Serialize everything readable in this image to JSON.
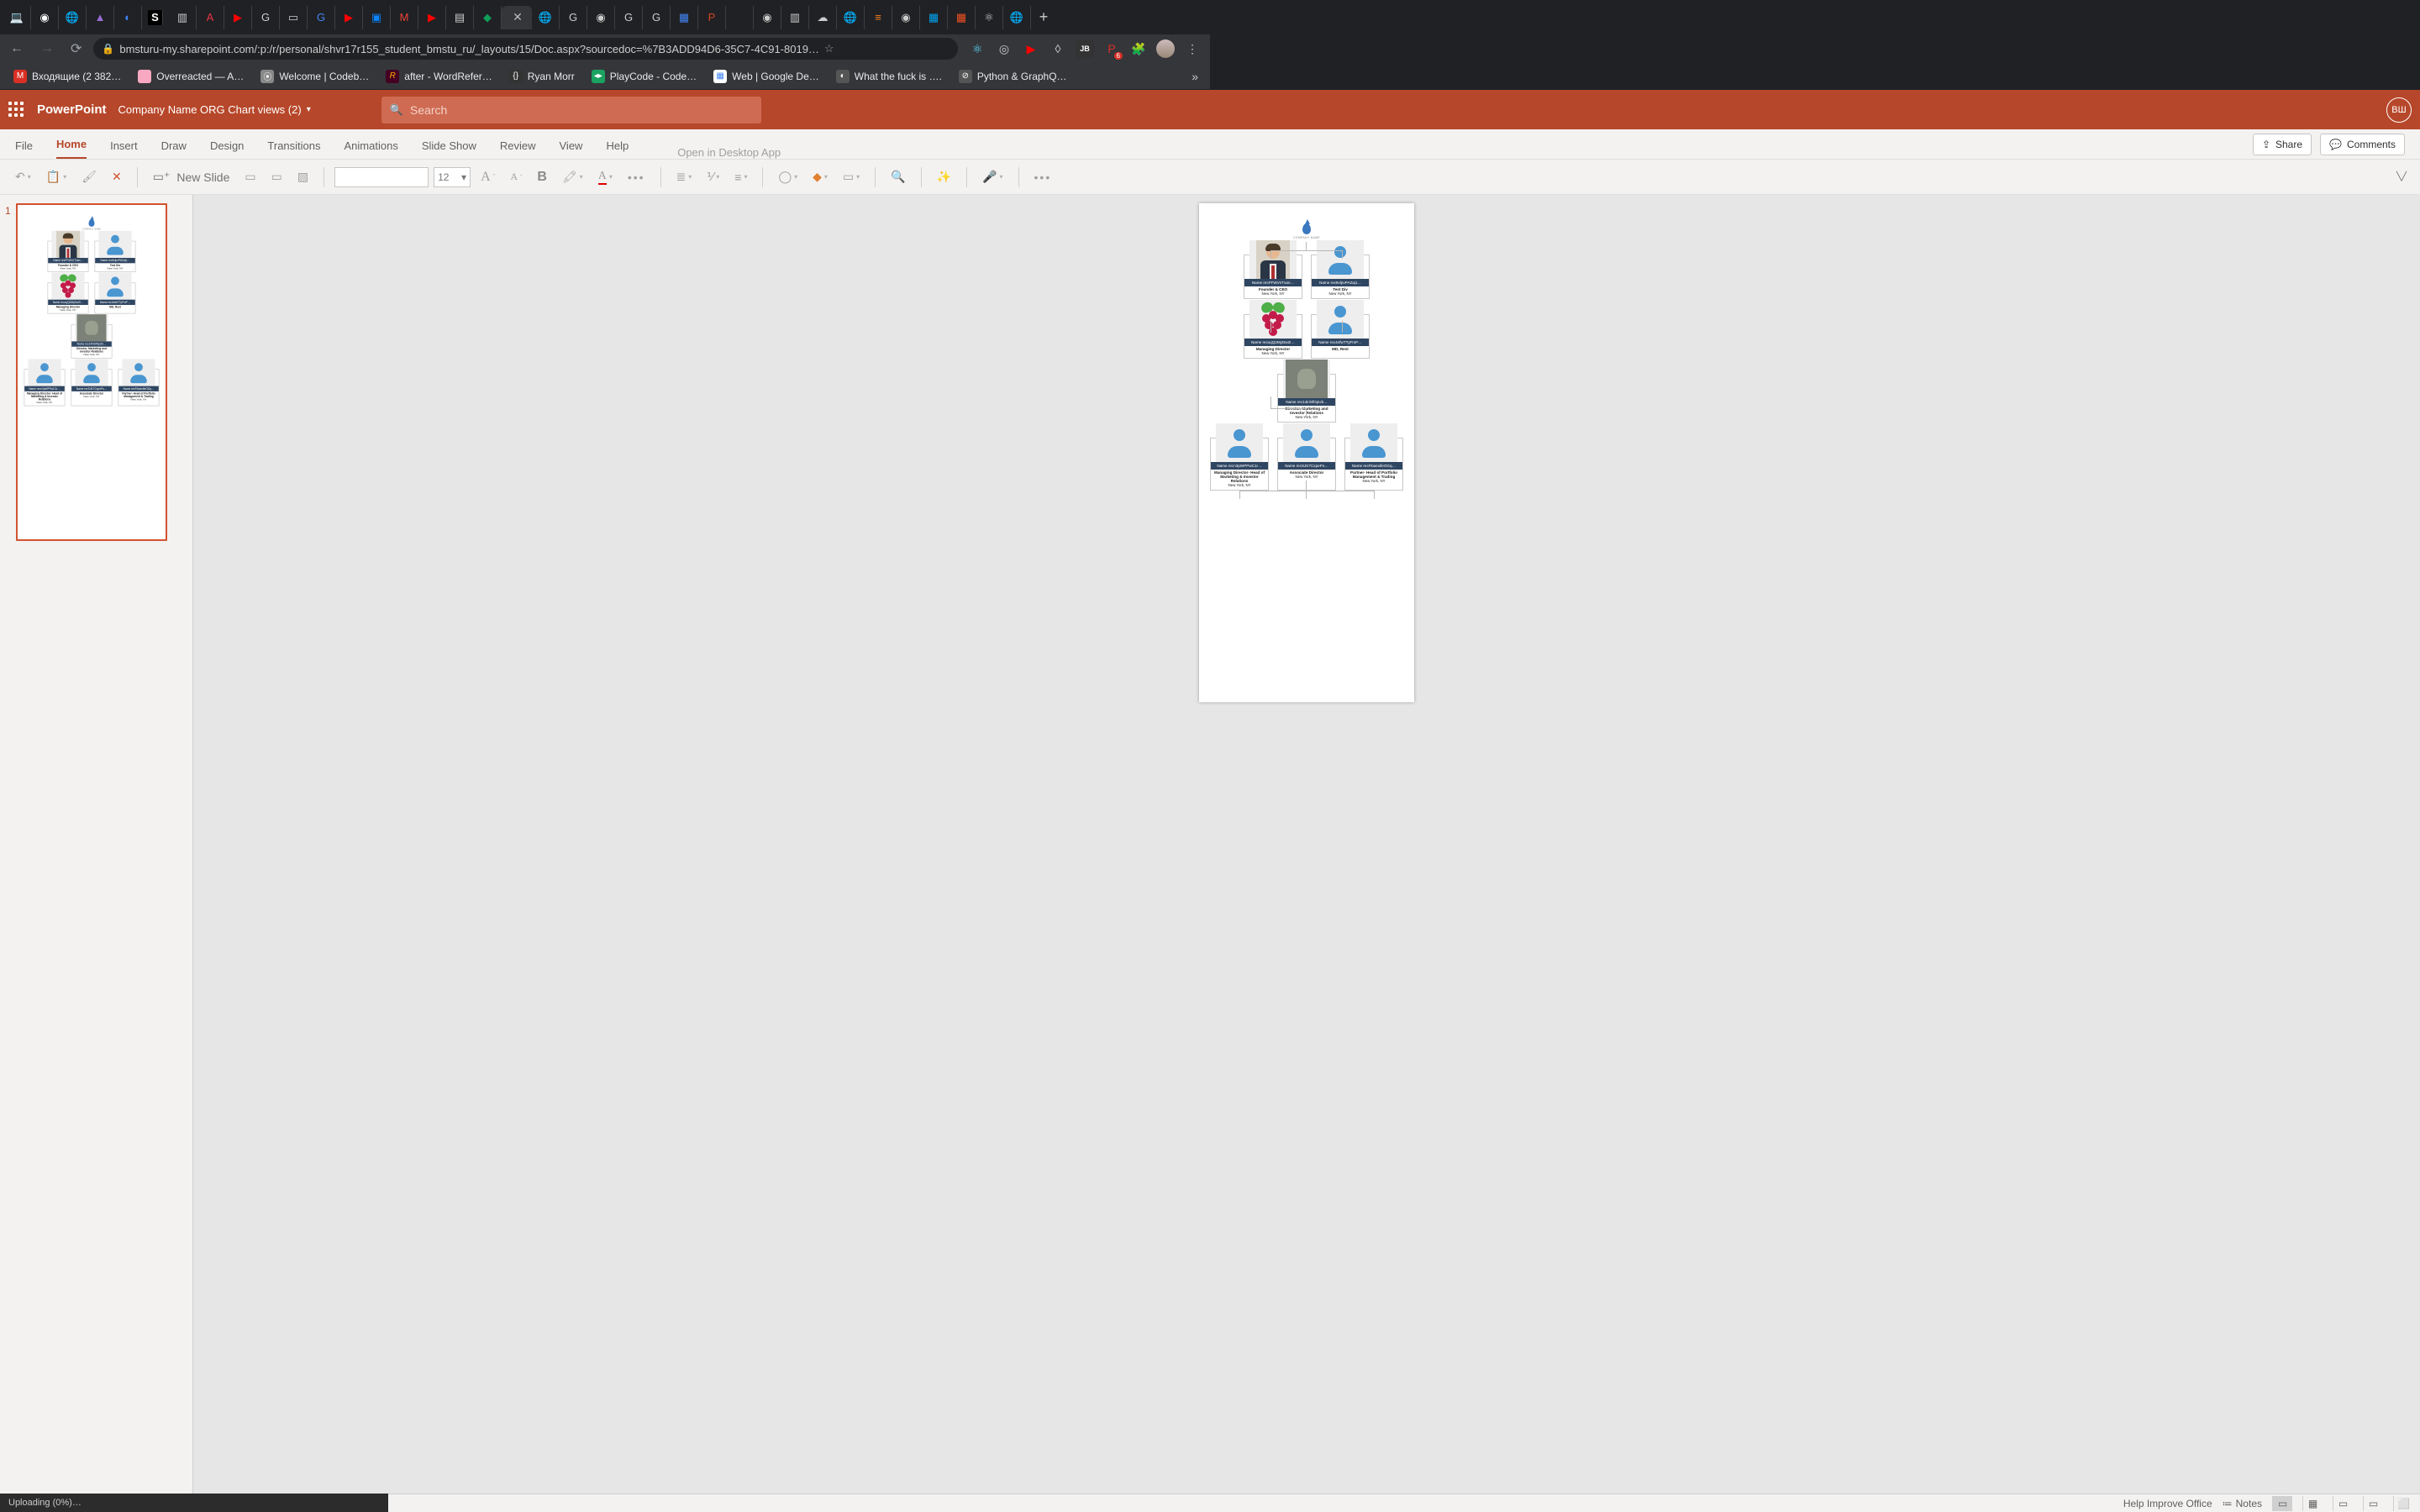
{
  "browser": {
    "url": "bmsturu-my.sharepoint.com/:p:/r/personal/shvr17r155_student_bmstu_ru/_layouts/15/Doc.aspx?sourcedoc=%7B3ADD94D6-35C7-4C91-8019…",
    "tabs_icons": [
      "laptop",
      "github",
      "cloud",
      "A",
      "cycle",
      "S",
      "book",
      "A",
      "yt",
      "G",
      "pad",
      "G",
      "yt",
      "app",
      "M",
      "yt",
      "doc",
      "drive",
      "active",
      "globe",
      "G",
      "github",
      "G",
      "G",
      "G",
      "P",
      "blank",
      "github",
      "book",
      "cloud",
      "globe",
      "so",
      "github",
      "grid",
      "grid",
      "atom",
      "globe"
    ],
    "bookmarks": [
      {
        "icon": "M",
        "text": "Входящие (2 382…",
        "color": "#d93025"
      },
      {
        "icon": "●",
        "text": "Overreacted — A…",
        "color": "#f9a8c1"
      },
      {
        "icon": "⦿",
        "text": "Welcome | Codeb…",
        "color": "#6b6b6b"
      },
      {
        "icon": "R",
        "text": "after - WordRefer…",
        "color": "#c03"
      },
      {
        "icon": "{}",
        "text": "Ryan Morr",
        "color": "#444"
      },
      {
        "icon": "<>",
        "text": "PlayCode - Code…",
        "color": "#1aa260"
      },
      {
        "icon": "▦",
        "text": "Web  |  Google De…",
        "color": "#4285f4"
      },
      {
        "icon": "◐",
        "text": "What the fuck is ….",
        "color": "#555"
      },
      {
        "icon": "⊘",
        "text": "Python & GraphQ…",
        "color": "#555"
      }
    ],
    "ext_badge": "6"
  },
  "app": {
    "name": "PowerPoint",
    "doc": "Company Name ORG Chart views (2)",
    "search_placeholder": "Search",
    "user_initials": "ВШ",
    "ribbon_tabs": [
      "File",
      "Home",
      "Insert",
      "Draw",
      "Design",
      "Transitions",
      "Animations",
      "Slide Show",
      "Review",
      "View",
      "Help"
    ],
    "active_tab": "Home",
    "open_desktop": "Open in Desktop App",
    "share": "Share",
    "comments": "Comments",
    "toolbar": {
      "new_slide": "New Slide",
      "font_size": "12"
    }
  },
  "slides": {
    "current_number": "1"
  },
  "org": {
    "company": "COMPANY NAME",
    "cards": [
      {
        "name": "Name recFFWVnTvan…",
        "role": "Founder & CEO",
        "loc": "New York, NY",
        "pic": "suit"
      },
      {
        "name": "Name rec9vlpvPAZaj1…",
        "role": "Test Div",
        "loc": "New York, NY",
        "pic": "person"
      },
      {
        "name": "Name recxqQ2MyDw2I…",
        "role": "Managing Director",
        "loc": "New York, NY",
        "pic": "rasp"
      },
      {
        "name": "Name rec4nfwTTyFmP…",
        "role": "MD, Rest",
        "loc": "",
        "pic": "person"
      },
      {
        "name": "Name rec14iriSfOpUb…",
        "role": "Director, Marketing and Investor Relations",
        "loc": "New York, NY",
        "pic": "yoda"
      },
      {
        "name": "Name recn3pWPPwC1r…",
        "role": "Managing Director- Head of Marketing & Investor Relations",
        "loc": "New York, NY",
        "pic": "person"
      },
      {
        "name": "Name recSJK7CxpePo…",
        "role": "Associate Director",
        "loc": "New York, NY",
        "pic": "person"
      },
      {
        "name": "Name recFkwexifeOGq…",
        "role": "Partner- Head of Portfolio Management & Trading",
        "loc": "New York, NY",
        "pic": "person"
      }
    ]
  },
  "status": {
    "left": "Uploading (0%)…",
    "improve": "Help Improve Office",
    "notes": "Notes"
  }
}
